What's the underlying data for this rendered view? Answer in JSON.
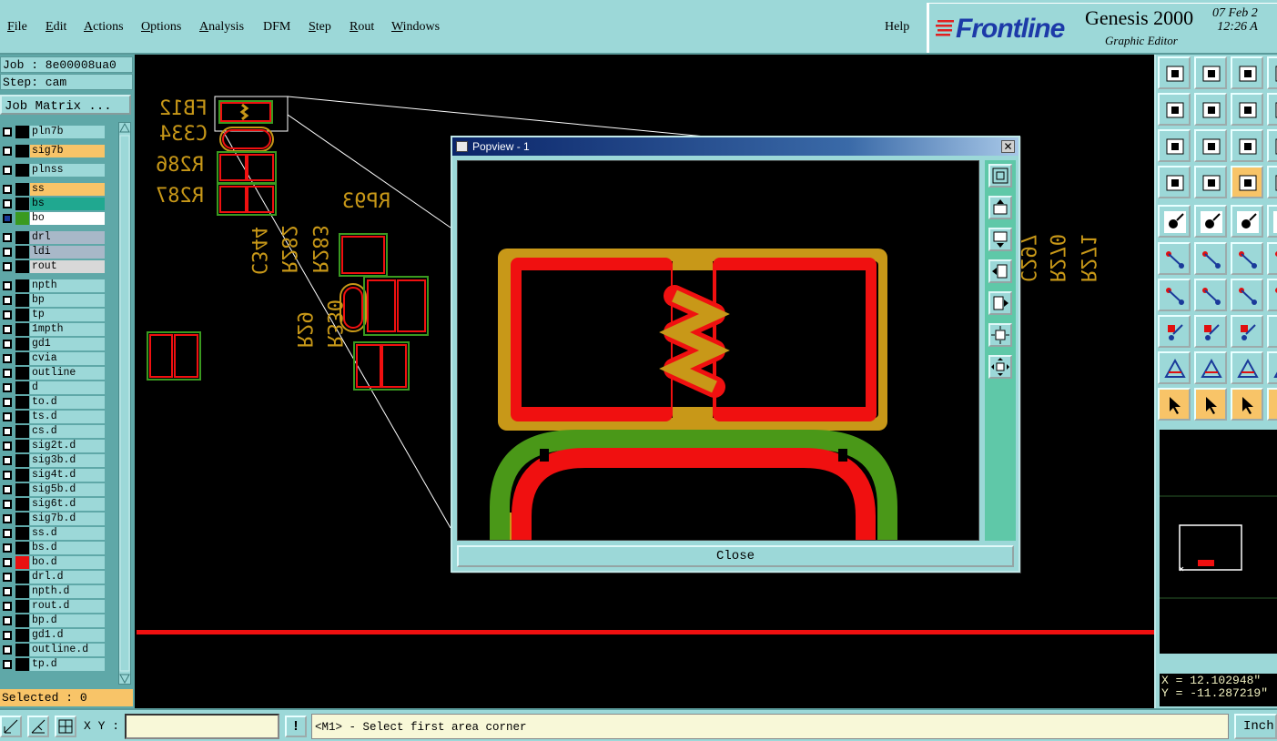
{
  "menubar": {
    "items": [
      {
        "label": "File",
        "u": "F",
        "rest": "ile"
      },
      {
        "label": "Edit",
        "u": "E",
        "rest": "dit"
      },
      {
        "label": "Actions",
        "u": "A",
        "rest": "ctions"
      },
      {
        "label": "Options",
        "u": "O",
        "rest": "ptions"
      },
      {
        "label": "Analysis",
        "u": "A",
        "rest": "nalysis"
      },
      {
        "label": "DFM",
        "u": "",
        "rest": "DFM"
      },
      {
        "label": "Step",
        "u": "S",
        "rest": "tep"
      },
      {
        "label": "Rout",
        "u": "R",
        "rest": "out"
      },
      {
        "label": "Windows",
        "u": "W",
        "rest": "indows"
      }
    ],
    "help": "Help"
  },
  "branding": {
    "logo": "Frontline",
    "product": "Genesis 2000",
    "subtitle": "Graphic Editor",
    "date": "07 Feb 2",
    "time": "12:26 A"
  },
  "job": {
    "job_line": "Job : 8e00008ua0",
    "step_line": "Step: cam",
    "job_matrix": "Job Matrix ..."
  },
  "layers": [
    {
      "name": "pln7b",
      "color": "#000000",
      "bg": "#9cd8d8"
    },
    {
      "name": "sig7b",
      "color": "#000000",
      "bg": "#f8c468"
    },
    {
      "name": "plnss",
      "color": "#000000",
      "bg": "#9cd8d8"
    },
    {
      "name": "ss",
      "color": "#000000",
      "bg": "#f8c468"
    },
    {
      "name": "bs",
      "color": "#000000",
      "bg": "#20a890"
    },
    {
      "name": "bo",
      "color": "#3a9a20",
      "bg": "#ffffff",
      "active": true
    },
    {
      "name": "drl",
      "color": "#000000",
      "bg": "#a8b8c8"
    },
    {
      "name": "ldi",
      "color": "#000000",
      "bg": "#a8b8c8"
    },
    {
      "name": "rout",
      "color": "#000000",
      "bg": "#d8d8d8"
    },
    {
      "name": "npth",
      "color": "#000000",
      "bg": "#9cd8d8"
    },
    {
      "name": "bp",
      "color": "#000000",
      "bg": "#9cd8d8"
    },
    {
      "name": "tp",
      "color": "#000000",
      "bg": "#9cd8d8"
    },
    {
      "name": "1mpth",
      "color": "#000000",
      "bg": "#9cd8d8"
    },
    {
      "name": "gd1",
      "color": "#000000",
      "bg": "#9cd8d8"
    },
    {
      "name": "cvia",
      "color": "#000000",
      "bg": "#9cd8d8"
    },
    {
      "name": "outline",
      "color": "#000000",
      "bg": "#9cd8d8"
    },
    {
      "name": "d",
      "color": "#000000",
      "bg": "#9cd8d8"
    },
    {
      "name": "to.d",
      "color": "#000000",
      "bg": "#9cd8d8"
    },
    {
      "name": "ts.d",
      "color": "#000000",
      "bg": "#9cd8d8"
    },
    {
      "name": "cs.d",
      "color": "#000000",
      "bg": "#9cd8d8"
    },
    {
      "name": "sig2t.d",
      "color": "#000000",
      "bg": "#9cd8d8"
    },
    {
      "name": "sig3b.d",
      "color": "#000000",
      "bg": "#9cd8d8"
    },
    {
      "name": "sig4t.d",
      "color": "#000000",
      "bg": "#9cd8d8"
    },
    {
      "name": "sig5b.d",
      "color": "#000000",
      "bg": "#9cd8d8"
    },
    {
      "name": "sig6t.d",
      "color": "#000000",
      "bg": "#9cd8d8"
    },
    {
      "name": "sig7b.d",
      "color": "#000000",
      "bg": "#9cd8d8"
    },
    {
      "name": "ss.d",
      "color": "#000000",
      "bg": "#9cd8d8"
    },
    {
      "name": "bs.d",
      "color": "#000000",
      "bg": "#9cd8d8"
    },
    {
      "name": "bo.d",
      "color": "#e81010",
      "bg": "#9cd8d8"
    },
    {
      "name": "drl.d",
      "color": "#000000",
      "bg": "#9cd8d8"
    },
    {
      "name": "npth.d",
      "color": "#000000",
      "bg": "#9cd8d8"
    },
    {
      "name": "rout.d",
      "color": "#000000",
      "bg": "#9cd8d8"
    },
    {
      "name": "bp.d",
      "color": "#000000",
      "bg": "#9cd8d8"
    },
    {
      "name": "gd1.d",
      "color": "#000000",
      "bg": "#9cd8d8"
    },
    {
      "name": "outline.d",
      "color": "#000000",
      "bg": "#9cd8d8"
    },
    {
      "name": "tp.d",
      "color": "#000000",
      "bg": "#9cd8d8"
    }
  ],
  "selected": "Selected : 0",
  "silkscreen": [
    "FB12",
    "C334",
    "R286",
    "R287",
    "RP93",
    "C344",
    "R282",
    "R283",
    "R29",
    "R330",
    "C297",
    "R270",
    "R271"
  ],
  "popview": {
    "title": "Popview - 1",
    "close_x": "✕",
    "close_label": "Close"
  },
  "coords": {
    "x": "X = 12.102948\"",
    "y": "Y = -11.287219\""
  },
  "statusbar": {
    "xy_label": "X Y :",
    "xy_value": "",
    "excl": "!",
    "message": "<M1> - Select first area corner",
    "units": "Inch"
  },
  "colors": {
    "panel": "#9cd8d8",
    "highlight": "#f8c468",
    "copper_red": "#f01010",
    "silk_gold": "#c89818",
    "outline_green": "#3a9a20"
  }
}
